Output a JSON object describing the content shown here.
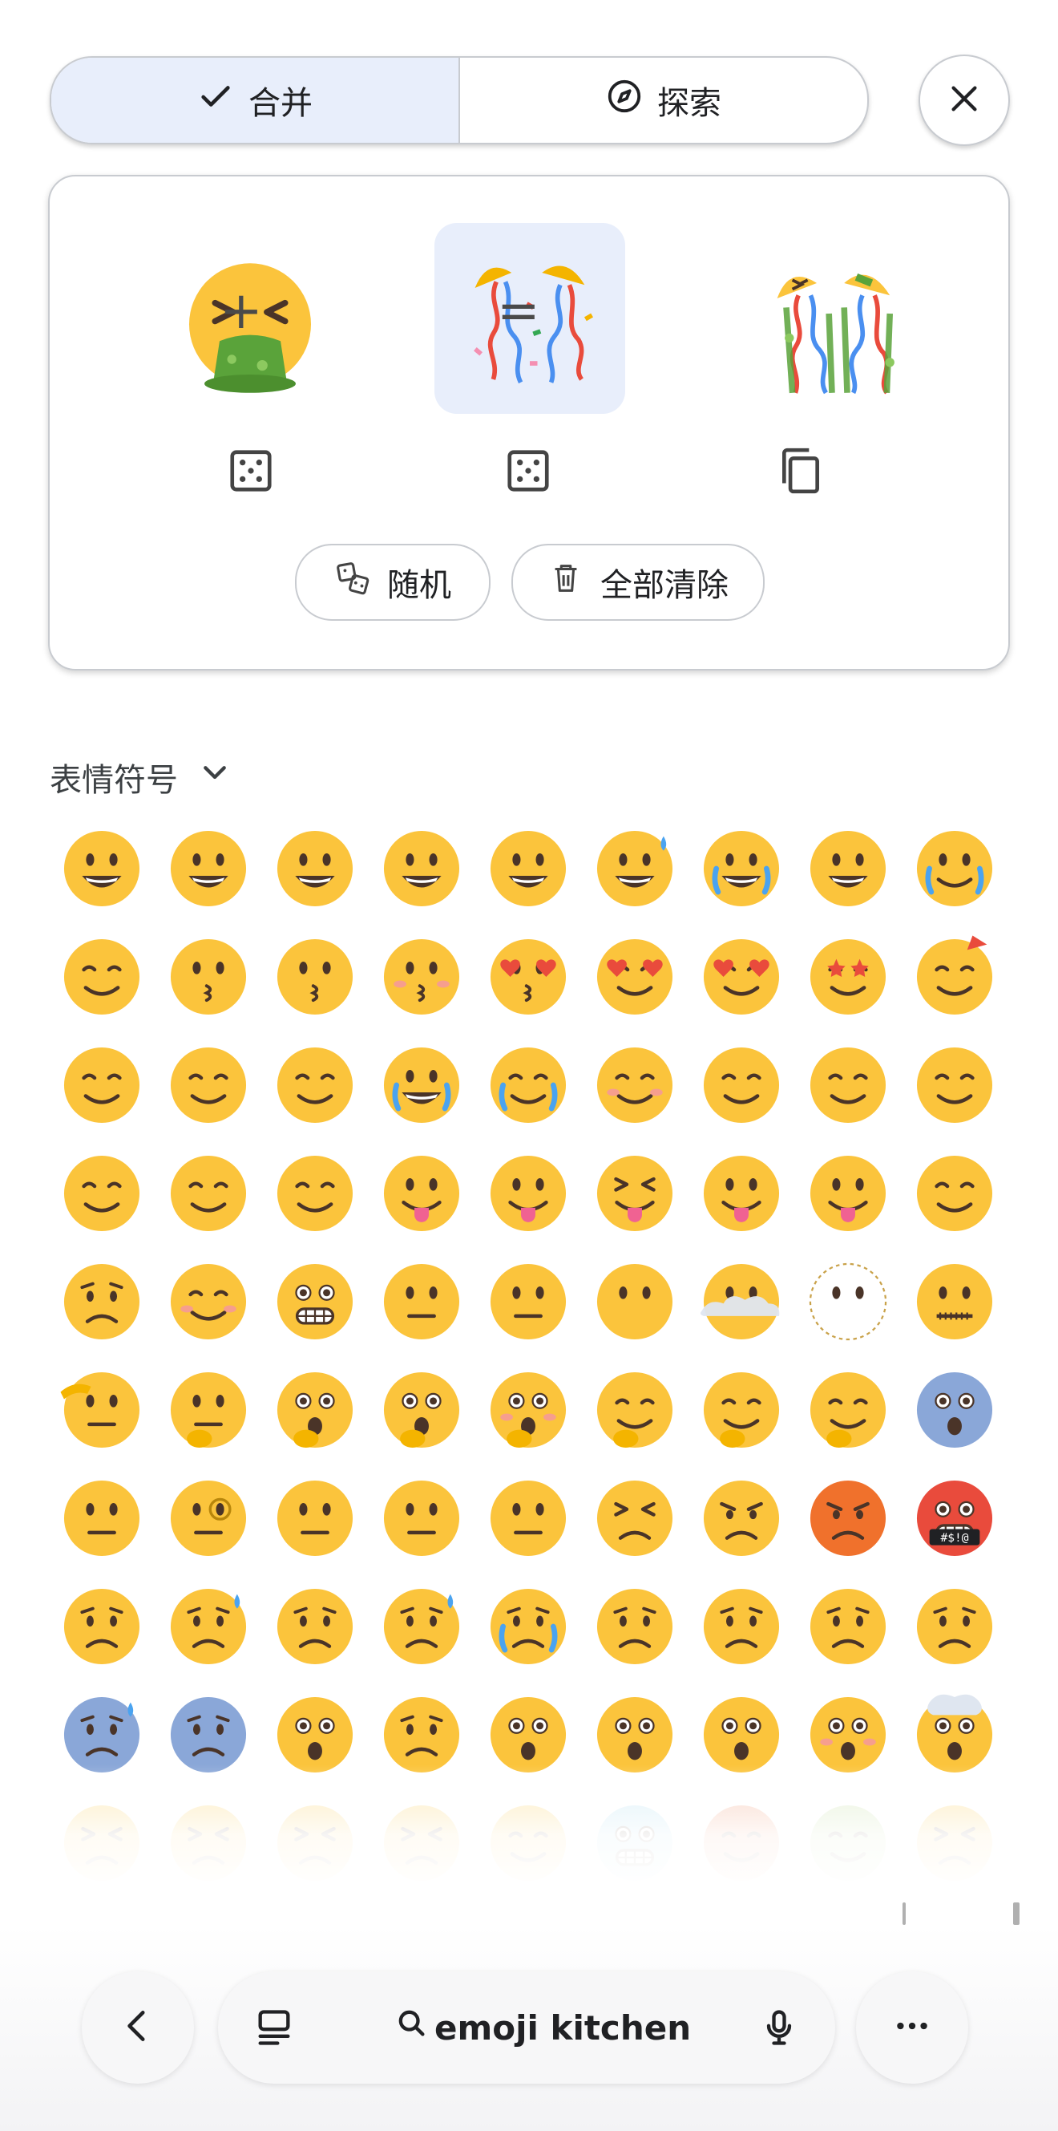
{
  "tabs": [
    {
      "label": "合并",
      "icon": "check-icon",
      "active": true
    },
    {
      "label": "探索",
      "icon": "compass-icon",
      "active": false
    }
  ],
  "close": {
    "icon": "close-icon"
  },
  "combine": {
    "plus": "+",
    "equals": "=",
    "left_emoji": "vomiting-face",
    "right_emoji": "party-popper",
    "result": "vomiting-party-popper-mix",
    "random_label": "随机",
    "clear_label": "全部清除"
  },
  "section": {
    "title": "表情符号"
  },
  "grid": {
    "rows": [
      [
        "grinning",
        "smiley",
        "smile",
        "grin",
        "laughing",
        "sweat-smile",
        "joy",
        "rofl",
        "sob"
      ],
      [
        "wink",
        "kissing",
        "kissing-smiling-eyes",
        "kissing-closed-eyes",
        "kissing-heart",
        "smiling-hearts",
        "heart-eyes",
        "star-struck",
        "partying"
      ],
      [
        "melting",
        "upside-down",
        "slight-smile",
        "smile-tear",
        "holding-back-tears",
        "blush",
        "relaxed",
        "relieved",
        "sleepy-lines"
      ],
      [
        "face-exhaling",
        "smirk",
        "drooling",
        "yum",
        "tongue",
        "squinting-tongue",
        "winking-tongue",
        "zany",
        "woozy"
      ],
      [
        "pensive",
        "pleading",
        "grimacing",
        "expressionless",
        "neutral",
        "no-mouth",
        "face-in-clouds",
        "dotted-line-face",
        "zipper-mouth"
      ],
      [
        "saluting",
        "thinking",
        "shushing",
        "hand-over-mouth",
        "hand-over-mouth-blush",
        "yawning",
        "hugging",
        "peeking",
        "scream"
      ],
      [
        "raised-eyebrow",
        "monocle",
        "unamused",
        "rolling-eyes",
        "sighing",
        "triumph",
        "angry",
        "rage",
        "cursing"
      ],
      [
        "disappointed",
        "downcast-sweat",
        "worried",
        "sad-sweat",
        "crying",
        "frowning",
        "slight-frown",
        "confused",
        "confused-2"
      ],
      [
        "anxious-sweat",
        "fearful",
        "hushed",
        "frowning-open",
        "astonished",
        "open-mouth",
        "open-mouth-2",
        "flushed",
        "exploding-head"
      ],
      [
        "tired",
        "tired-2",
        "persevering",
        "confounded",
        "dizzy",
        "cold",
        "hot",
        "nauseated",
        "weary"
      ]
    ]
  },
  "bottom": {
    "search_text": "emoji kitchen",
    "icons": [
      "back-icon",
      "tabs-icon",
      "search-icon",
      "mic-icon",
      "more-icon"
    ]
  },
  "colors": {
    "accent_bg": "#e8eefb",
    "border": "#c8cbd0",
    "emoji_yellow": "#fbc43c",
    "emoji_dark": "#4a3428"
  }
}
